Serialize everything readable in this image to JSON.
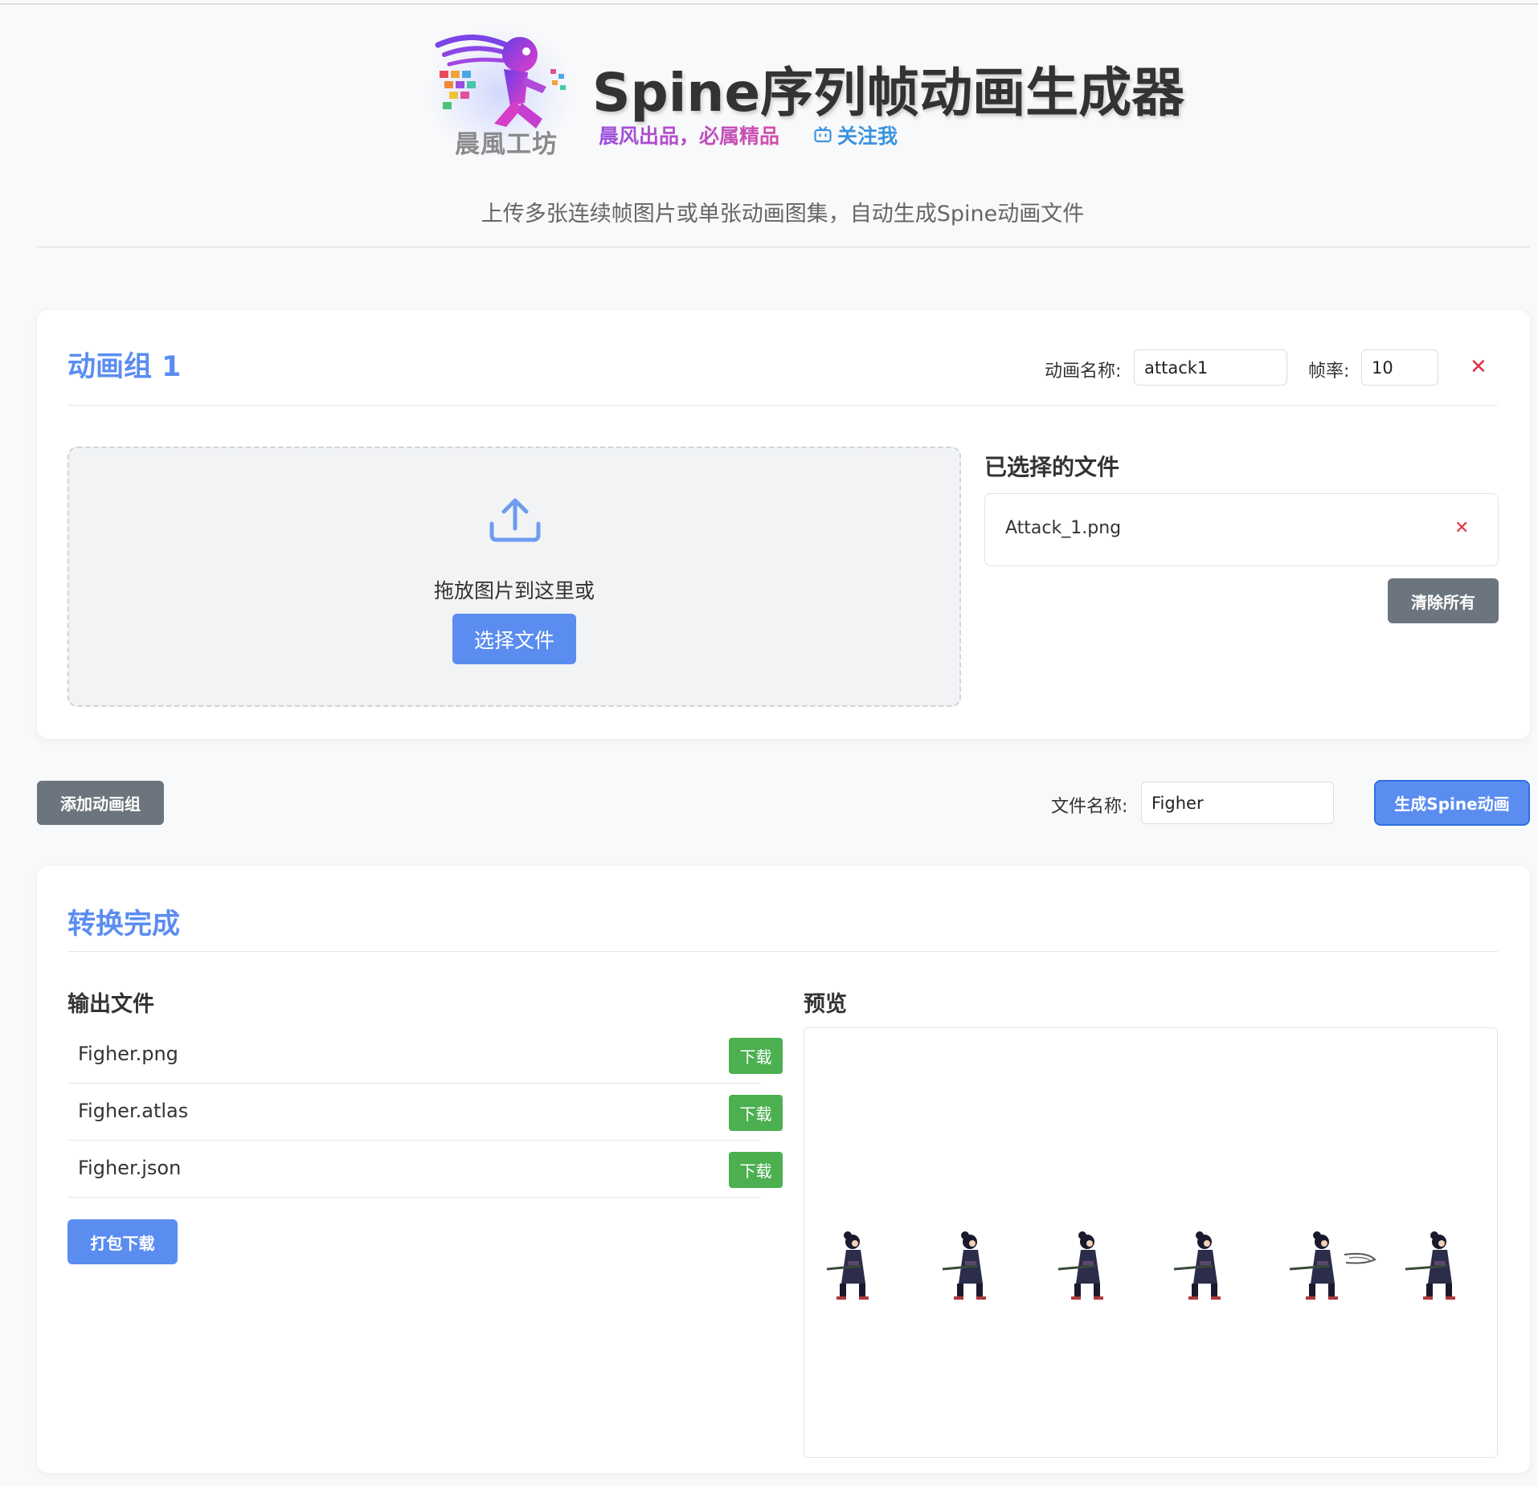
{
  "header": {
    "logo_text": "晨風工坊",
    "title": "Spine序列帧动画生成器",
    "slogan": "晨风出品，必属精品",
    "follow_label": "关注我",
    "subtitle": "上传多张连续帧图片或单张动画图集，自动生成Spine动画文件"
  },
  "group": {
    "title": "动画组 1",
    "name_label": "动画名称:",
    "name_value": "attack1",
    "fps_label": "帧率:",
    "fps_value": "10",
    "drop_text": "拖放图片到这里或",
    "select_label": "选择文件",
    "selected_title": "已选择的文件",
    "files": [
      {
        "name": "Attack_1.png"
      }
    ],
    "clear_label": "清除所有"
  },
  "toolbar": {
    "add_group_label": "添加动画组",
    "filename_label": "文件名称:",
    "filename_value": "Figher",
    "generate_label": "生成Spine动画"
  },
  "result": {
    "title": "转换完成",
    "output_title": "输出文件",
    "outputs": [
      {
        "name": "Figher.png",
        "action": "下载"
      },
      {
        "name": "Figher.atlas",
        "action": "下载"
      },
      {
        "name": "Figher.json",
        "action": "下载"
      }
    ],
    "pack_label": "打包下载",
    "preview_title": "预览",
    "frame_count": 6
  },
  "colors": {
    "accent": "#5b8df0",
    "secondary": "#6c757d",
    "success": "#4caf50",
    "danger": "#dc3545",
    "follow": "#3b93e0"
  },
  "icons": {
    "follow": "tv-icon",
    "upload": "upload-icon",
    "remove": "close-icon"
  }
}
